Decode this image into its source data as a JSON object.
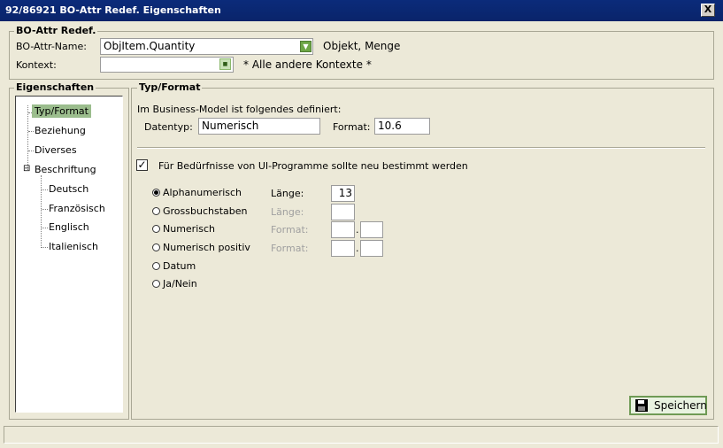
{
  "window": {
    "title": "92/86921 BO-Attr Redef. Eigenschaften",
    "close_glyph": "X"
  },
  "bo_group": {
    "label": "BO-Attr Redef.",
    "name_label": "BO-Attr-Name:",
    "name_value": "ObjItem.Quantity",
    "name_desc": "Objekt, Menge",
    "context_label": "Kontext:",
    "context_value": "",
    "context_desc": "* Alle andere Kontexte *"
  },
  "properties_group": {
    "label": "Eigenschaften",
    "tree": [
      {
        "label": "Typ/Format",
        "selected": true
      },
      {
        "label": "Beziehung"
      },
      {
        "label": "Diverses"
      },
      {
        "label": "Beschriftung",
        "expander": "⊟"
      },
      {
        "label": "Deutsch"
      },
      {
        "label": "Französisch"
      },
      {
        "label": "Englisch"
      },
      {
        "label": "Italienisch"
      }
    ]
  },
  "typ_format": {
    "label": "Typ/Format",
    "intro": "Im Business-Model ist folgendes definiert:",
    "datentyp_label": "Datentyp:",
    "datentyp_value": "Numerisch",
    "format_label": "Format:",
    "format_value": "10.6",
    "redefine_label": "Für Bedürfnisse von UI-Programme sollte neu bestimmt werden",
    "redefine_checked": true,
    "options": [
      {
        "label": "Alphanumerisch",
        "selected": true,
        "field_label": "Länge:",
        "field_value": "13"
      },
      {
        "label": "Grossbuchstaben",
        "selected": false,
        "field_label": "Länge:",
        "field_value": ""
      },
      {
        "label": "Numerisch",
        "selected": false,
        "field_label": "Format:",
        "field_value": "",
        "sep": "."
      },
      {
        "label": "Numerisch positiv",
        "selected": false,
        "field_label": "Format:",
        "field_value": "",
        "sep": "."
      },
      {
        "label": "Datum",
        "selected": false
      },
      {
        "label": "Ja/Nein",
        "selected": false
      }
    ]
  },
  "save_button": {
    "label": "Speichern",
    "icon": "floppy-disk-icon"
  },
  "colors": {
    "title_bar": "#0a246a",
    "selection": "#9bbd8d",
    "accent_green": "#6da646"
  }
}
